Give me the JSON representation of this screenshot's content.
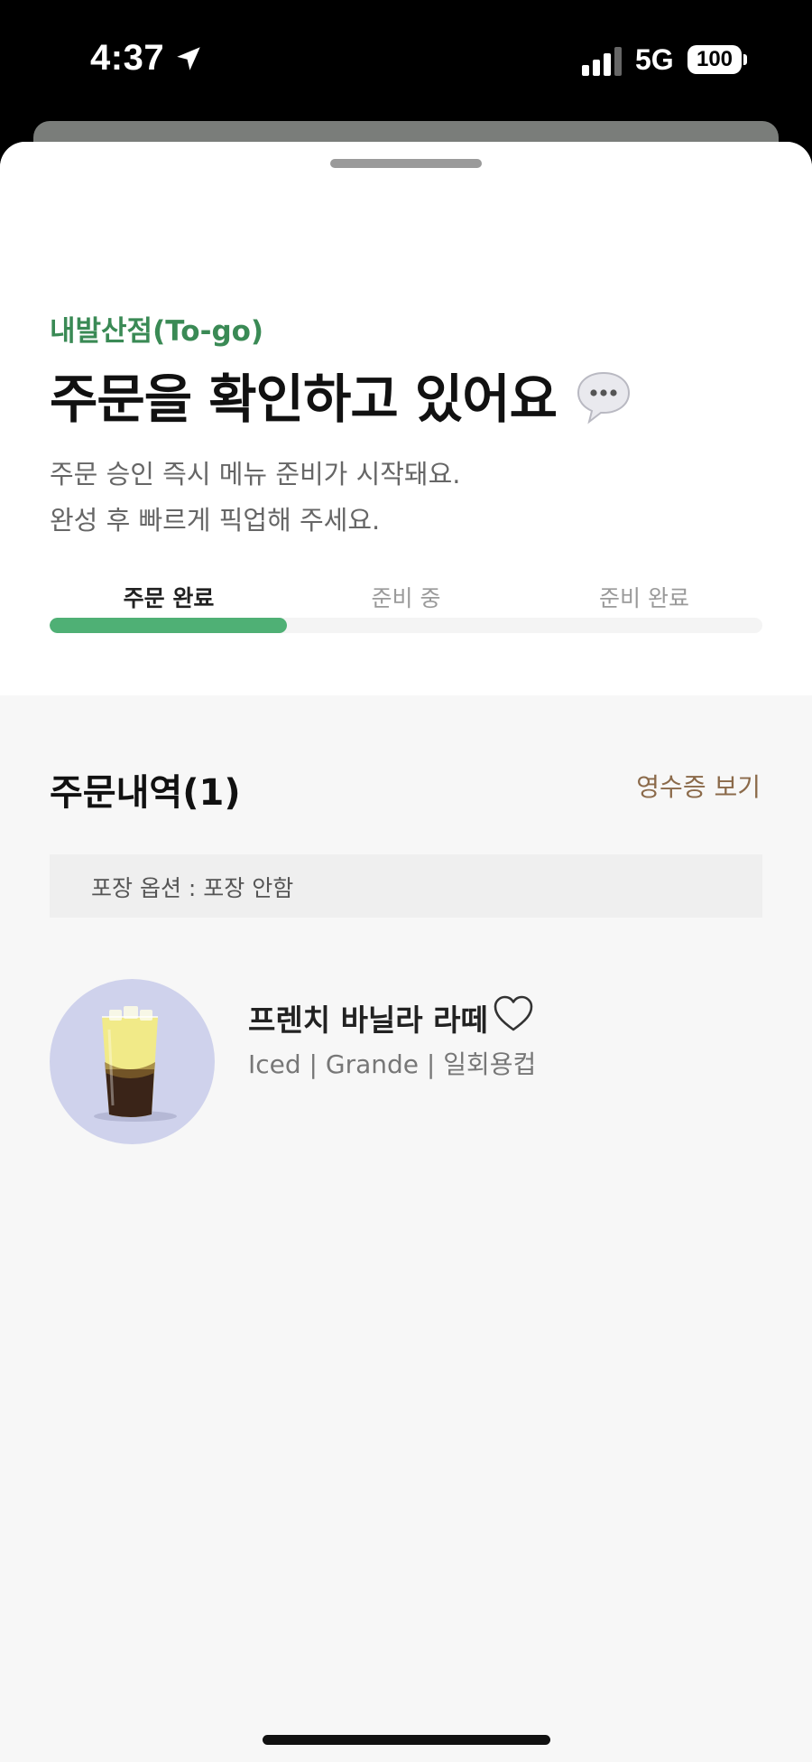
{
  "status_bar": {
    "time": "4:37",
    "network": "5G",
    "battery": "100"
  },
  "order": {
    "store": "내발산점(To-go)",
    "title": "주문을 확인하고 있어요",
    "description_lines": [
      "주문 승인 즉시 메뉴 준비가 시작돼요.",
      "완성 후 빠르게 픽업해 주세요."
    ],
    "steps": [
      "주문 완료",
      "준비 중",
      "준비 완료"
    ],
    "current_step": 1,
    "progress_fraction": 0.3333
  },
  "history": {
    "title": "주문내역(1)",
    "receipt_label": "영수증 보기",
    "packaging_option": "포장 옵션 : 포장 안함",
    "items": [
      {
        "name": "프렌치 바닐라 라떼",
        "options": "Iced | Grande | 일회용컵"
      }
    ]
  },
  "colors": {
    "accent_green": "#4fb075",
    "store_green": "#3a8a55",
    "link_brown": "#8b6a4a",
    "thumb_bg": "#cfd2ec"
  }
}
